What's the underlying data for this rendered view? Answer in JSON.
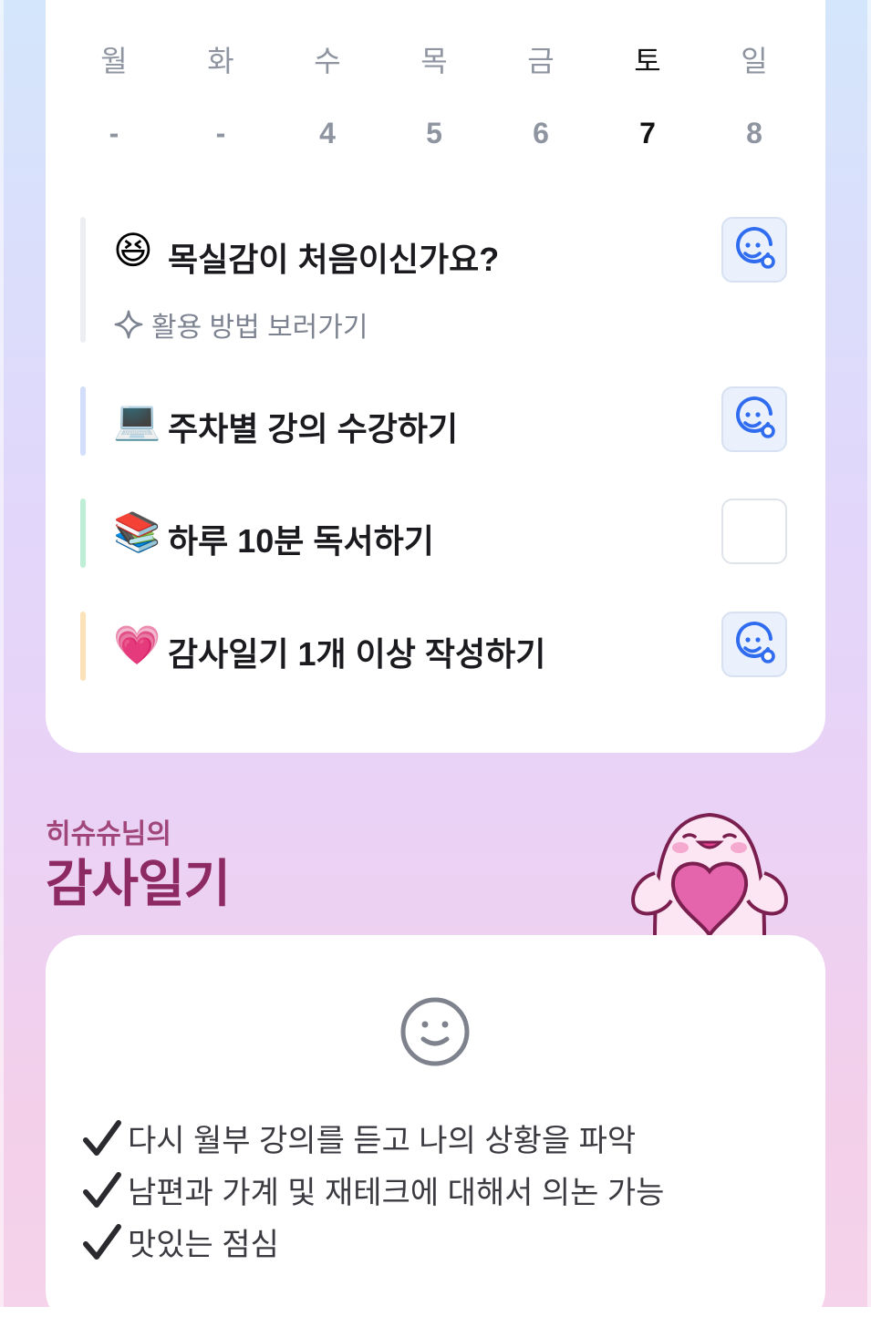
{
  "week": {
    "days": [
      {
        "name": "월",
        "num": "-"
      },
      {
        "name": "화",
        "num": "-"
      },
      {
        "name": "수",
        "num": "4"
      },
      {
        "name": "목",
        "num": "5"
      },
      {
        "name": "금",
        "num": "6"
      },
      {
        "name": "토",
        "num": "7"
      },
      {
        "name": "일",
        "num": "8"
      }
    ],
    "active_day": "토"
  },
  "tasks": [
    {
      "emoji": "😆",
      "title": "목실감이 처음이신가요?",
      "link": "활용 방법 보러가기",
      "checked": true,
      "bar_color": "#eceef2"
    },
    {
      "emoji": "💻",
      "title": "주차별 강의 수강하기",
      "checked": true,
      "bar_color": "#d3defa"
    },
    {
      "emoji": "📚",
      "title": "하루 10분 독서하기",
      "checked": false,
      "bar_color": "#bfeed6"
    },
    {
      "emoji": "💗",
      "title": "감사일기 1개 이상 작성하기",
      "checked": true,
      "bar_color": "#fbe2b9"
    }
  ],
  "diary": {
    "owner": "히슈슈님의",
    "title": "감사일기",
    "items": [
      " 다시 월부 강의를 듣고 나의 상황을 파악",
      "남편과 가계 및 재테크에 대해서 의논 가능",
      "맛있는 점심"
    ]
  },
  "icons": {
    "check": "smile-check-icon",
    "link": "sparkle-icon",
    "diary_face": "smile-face-icon",
    "tick": "checkmark-icon",
    "mascot": "mascot-holding-heart"
  },
  "colors": {
    "accent_blue": "#2f6cf0",
    "diary_title": "#8e2a63",
    "mascot_pink": "#e565ad"
  }
}
